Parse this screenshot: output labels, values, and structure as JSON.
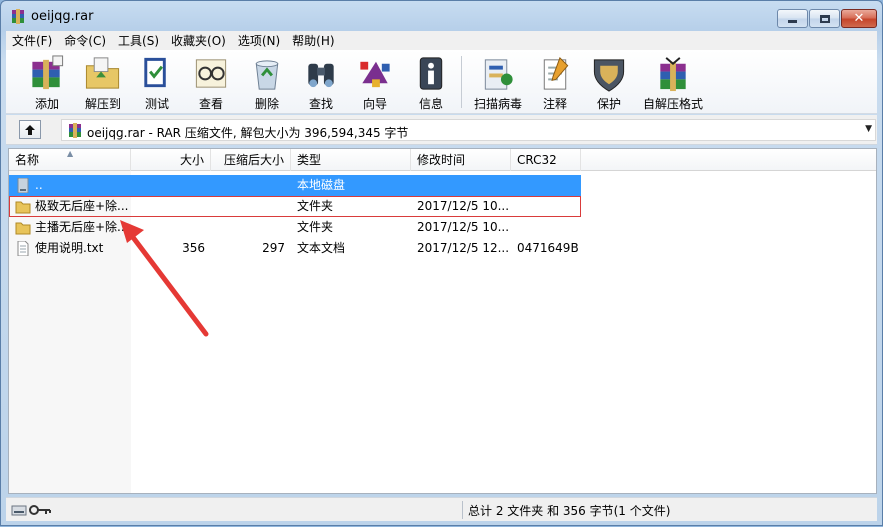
{
  "window": {
    "title": "oeijqg.rar"
  },
  "menu": [
    "文件(F)",
    "命令(C)",
    "工具(S)",
    "收藏夹(O)",
    "选项(N)",
    "帮助(H)"
  ],
  "toolbar": {
    "add": "添加",
    "extract_to": "解压到",
    "test": "测试",
    "view": "查看",
    "delete": "删除",
    "find": "查找",
    "wizard": "向导",
    "info": "信息",
    "virus_scan": "扫描病毒",
    "comment": "注释",
    "protect": "保护",
    "sfx": "自解压格式"
  },
  "address": {
    "path": "oeijqg.rar - RAR 压缩文件, 解包大小为 396,594,345 字节"
  },
  "columns": {
    "name": "名称",
    "size": "大小",
    "packed": "压缩后大小",
    "type": "类型",
    "modified": "修改时间",
    "crc": "CRC32"
  },
  "files": [
    {
      "name": "..",
      "size": "",
      "packed": "",
      "type": "本地磁盘",
      "modified": "",
      "crc": "",
      "icon": "drive-icon"
    },
    {
      "name": "极致无后座+除...",
      "size": "",
      "packed": "",
      "type": "文件夹",
      "modified": "2017/12/5 10...",
      "crc": "",
      "icon": "folder-icon"
    },
    {
      "name": "主播无后座+除...",
      "size": "",
      "packed": "",
      "type": "文件夹",
      "modified": "2017/12/5 10...",
      "crc": "",
      "icon": "folder-icon"
    },
    {
      "name": "使用说明.txt",
      "size": "356",
      "packed": "297",
      "type": "文本文档",
      "modified": "2017/12/5 12...",
      "crc": "0471649B",
      "icon": "text-file-icon"
    }
  ],
  "status": {
    "summary": "总计 2 文件夹 和 356 字节(1 个文件)"
  },
  "colors": {
    "selection": "#3399ff",
    "annotation": "#e53935"
  }
}
